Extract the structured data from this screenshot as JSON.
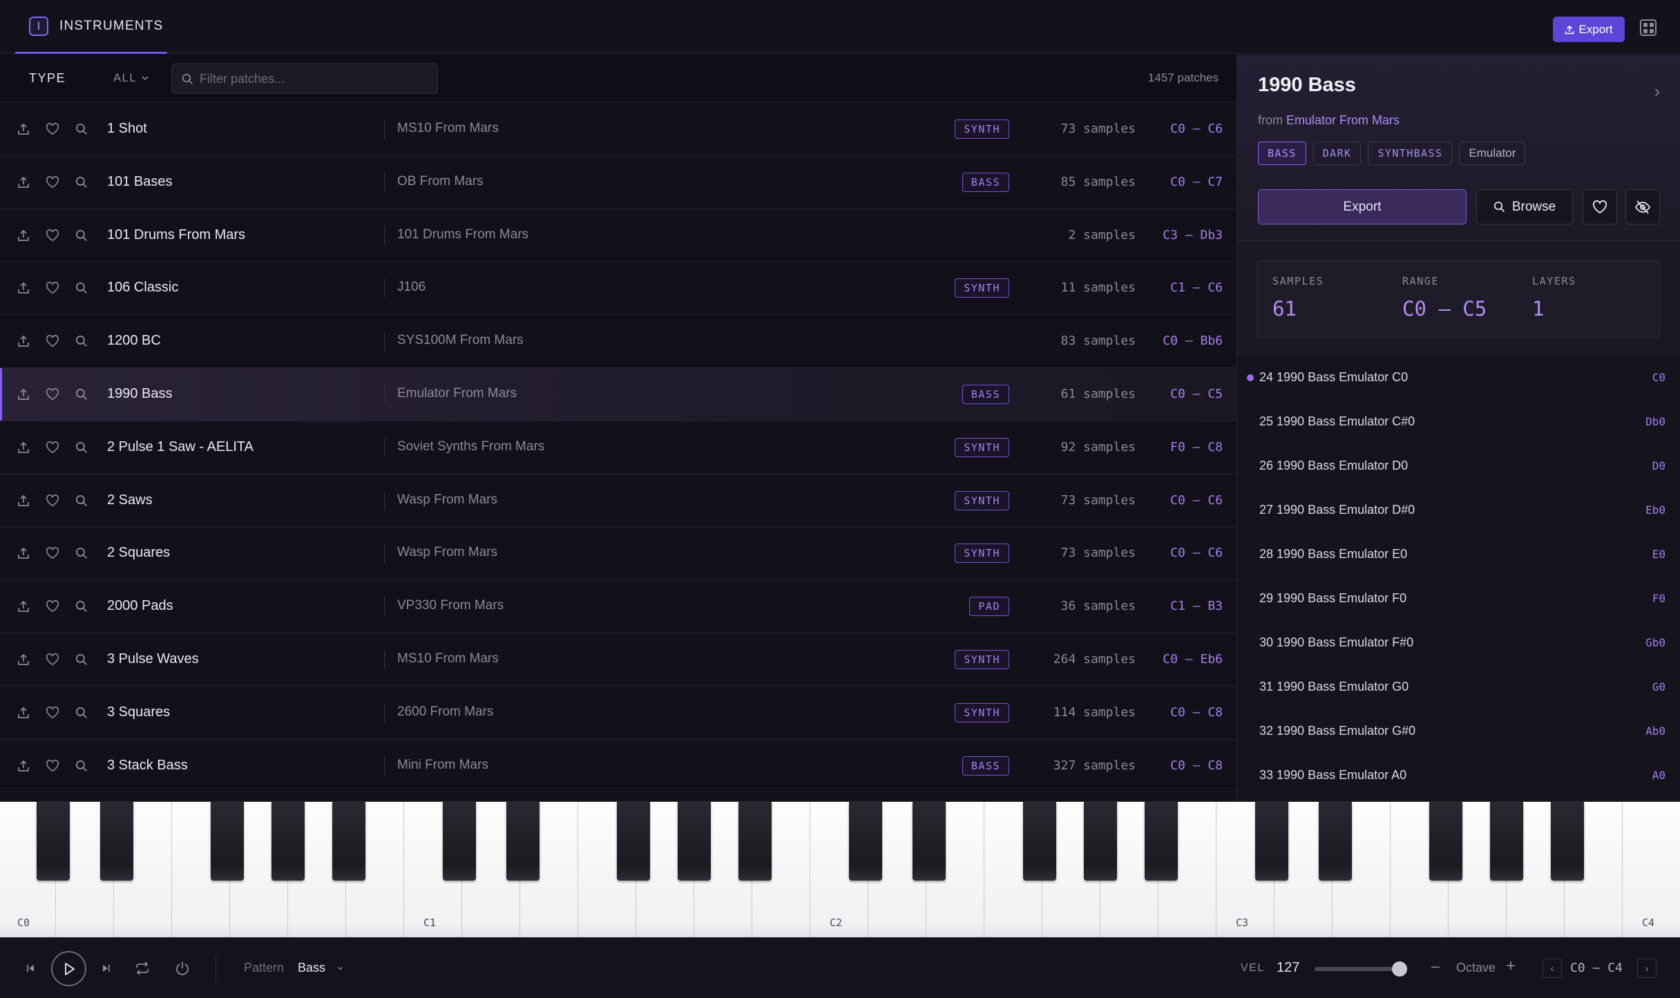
{
  "header": {
    "tab_badge": "I",
    "tab_label": "INSTRUMENTS",
    "export_label": "Export"
  },
  "filter": {
    "type_label": "TYPE",
    "type_value": "ALL",
    "search_placeholder": "Filter patches...",
    "patch_count": "1457 patches"
  },
  "patches": [
    {
      "name": "1 Shot",
      "source": "MS10 From Mars",
      "tag": "SYNTH",
      "samples": "73 samples",
      "range": "C0 – C6"
    },
    {
      "name": "101 Bases",
      "source": "OB From Mars",
      "tag": "BASS",
      "samples": "85 samples",
      "range": "C0 – C7"
    },
    {
      "name": "101 Drums From Mars",
      "source": "101 Drums From Mars",
      "tag": "",
      "samples": "2 samples",
      "range": "C3 – Db3"
    },
    {
      "name": "106 Classic",
      "source": "J106",
      "tag": "SYNTH",
      "samples": "11 samples",
      "range": "C1 – C6"
    },
    {
      "name": "1200 BC",
      "source": "SYS100M From Mars",
      "tag": "",
      "samples": "83 samples",
      "range": "C0 – Bb6"
    },
    {
      "name": "1990 Bass",
      "source": "Emulator From Mars",
      "tag": "BASS",
      "samples": "61 samples",
      "range": "C0 – C5",
      "selected": true
    },
    {
      "name": "2 Pulse 1 Saw - AELITA",
      "source": "Soviet Synths From Mars",
      "tag": "SYNTH",
      "samples": "92 samples",
      "range": "F0 – C8"
    },
    {
      "name": "2 Saws",
      "source": "Wasp From Mars",
      "tag": "SYNTH",
      "samples": "73 samples",
      "range": "C0 – C6"
    },
    {
      "name": "2 Squares",
      "source": "Wasp From Mars",
      "tag": "SYNTH",
      "samples": "73 samples",
      "range": "C0 – C6"
    },
    {
      "name": "2000 Pads",
      "source": "VP330 From Mars",
      "tag": "PAD",
      "samples": "36 samples",
      "range": "C1 – B3"
    },
    {
      "name": "3 Pulse Waves",
      "source": "MS10 From Mars",
      "tag": "SYNTH",
      "samples": "264 samples",
      "range": "C0 – Eb6"
    },
    {
      "name": "3 Squares",
      "source": "2600 From Mars",
      "tag": "SYNTH",
      "samples": "114 samples",
      "range": "C0 – C8"
    },
    {
      "name": "3 Stack Bass",
      "source": "Mini From Mars",
      "tag": "BASS",
      "samples": "327 samples",
      "range": "C0 – C8"
    }
  ],
  "detail": {
    "title": "1990 Bass",
    "from_prefix": "from",
    "from_link": "Emulator From Mars",
    "tags": [
      {
        "label": "BASS",
        "style": "active"
      },
      {
        "label": "DARK",
        "style": "normal"
      },
      {
        "label": "SYNTHBASS",
        "style": "normal"
      },
      {
        "label": "Emulator",
        "style": "plain"
      }
    ],
    "export_label": "Export",
    "browse_label": "Browse",
    "stats": [
      {
        "label": "SAMPLES",
        "value": "61"
      },
      {
        "label": "RANGE",
        "value": "C0 – C5"
      },
      {
        "label": "LAYERS",
        "value": "1"
      }
    ],
    "zones": [
      {
        "name": "24 1990 Bass Emulator C0",
        "note": "C0",
        "active": true
      },
      {
        "name": "25 1990 Bass Emulator C#0",
        "note": "Db0"
      },
      {
        "name": "26 1990 Bass Emulator D0",
        "note": "D0"
      },
      {
        "name": "27 1990 Bass Emulator D#0",
        "note": "Eb0"
      },
      {
        "name": "28 1990 Bass Emulator E0",
        "note": "E0"
      },
      {
        "name": "29 1990 Bass Emulator F0",
        "note": "F0"
      },
      {
        "name": "30 1990 Bass Emulator F#0",
        "note": "Gb0"
      },
      {
        "name": "31 1990 Bass Emulator G0",
        "note": "G0"
      },
      {
        "name": "32 1990 Bass Emulator G#0",
        "note": "Ab0"
      },
      {
        "name": "33 1990 Bass Emulator A0",
        "note": "A0"
      }
    ]
  },
  "piano": {
    "octave_labels": [
      "C0",
      "C1",
      "C2",
      "C3",
      "C4"
    ],
    "white_key_count": 29
  },
  "transport": {
    "pattern_label": "Pattern",
    "pattern_value": "Bass",
    "vel_label": "VEL",
    "vel_value": "127",
    "vel_fraction": 1.0,
    "octave_minus": "–",
    "octave_label": "Octave",
    "octave_plus": "+",
    "range": "C0 – C4"
  },
  "colors": {
    "accent": "#8b5cf6",
    "export_button": "#5b46d9",
    "range_text": "#a57ff2"
  }
}
